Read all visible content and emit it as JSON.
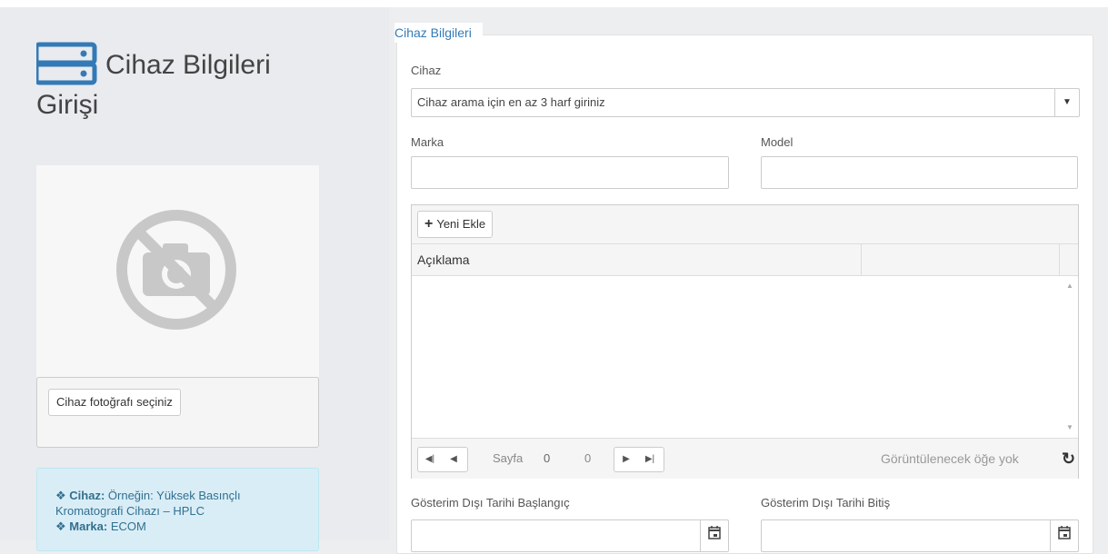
{
  "page": {
    "title_line1": "Cihaz Bilgileri",
    "title_line2": "Girişi",
    "title_icon": "server-icon"
  },
  "photo": {
    "placeholder_icon": "no-camera-icon",
    "select_button": "Cihaz fotoğrafı seçiniz"
  },
  "info": {
    "cihaz_label": "Cihaz:",
    "cihaz_text": "Örneğin: Yüksek Basınçlı",
    "cihaz_text2": "Kromatografi Cihazı – HPLC",
    "marka_label": "Marka:",
    "marka_text": "ECOM"
  },
  "form": {
    "legend": "Cihaz Bilgileri",
    "cihaz_label": "Cihaz",
    "cihaz_placeholder": "Cihaz arama için en az 3 harf giriniz",
    "marka_label": "Marka",
    "marka_value": "",
    "model_label": "Model",
    "model_value": "",
    "start_date_label": "Gösterim Dışı Tarihi Başlangıç",
    "end_date_label": "Gösterim Dışı Tarihi Bitiş"
  },
  "grid": {
    "add_button": "Yeni Ekle",
    "columns": [
      "Açıklama",
      ""
    ],
    "rows": [],
    "pager": {
      "page_label": "Sayfa",
      "page_value": "0",
      "total": "0",
      "empty_message": "Görüntülenecek öğe yok"
    }
  },
  "colors": {
    "accent": "#337ab7",
    "info_bg": "#d9edf7",
    "info_text": "#31708f"
  }
}
